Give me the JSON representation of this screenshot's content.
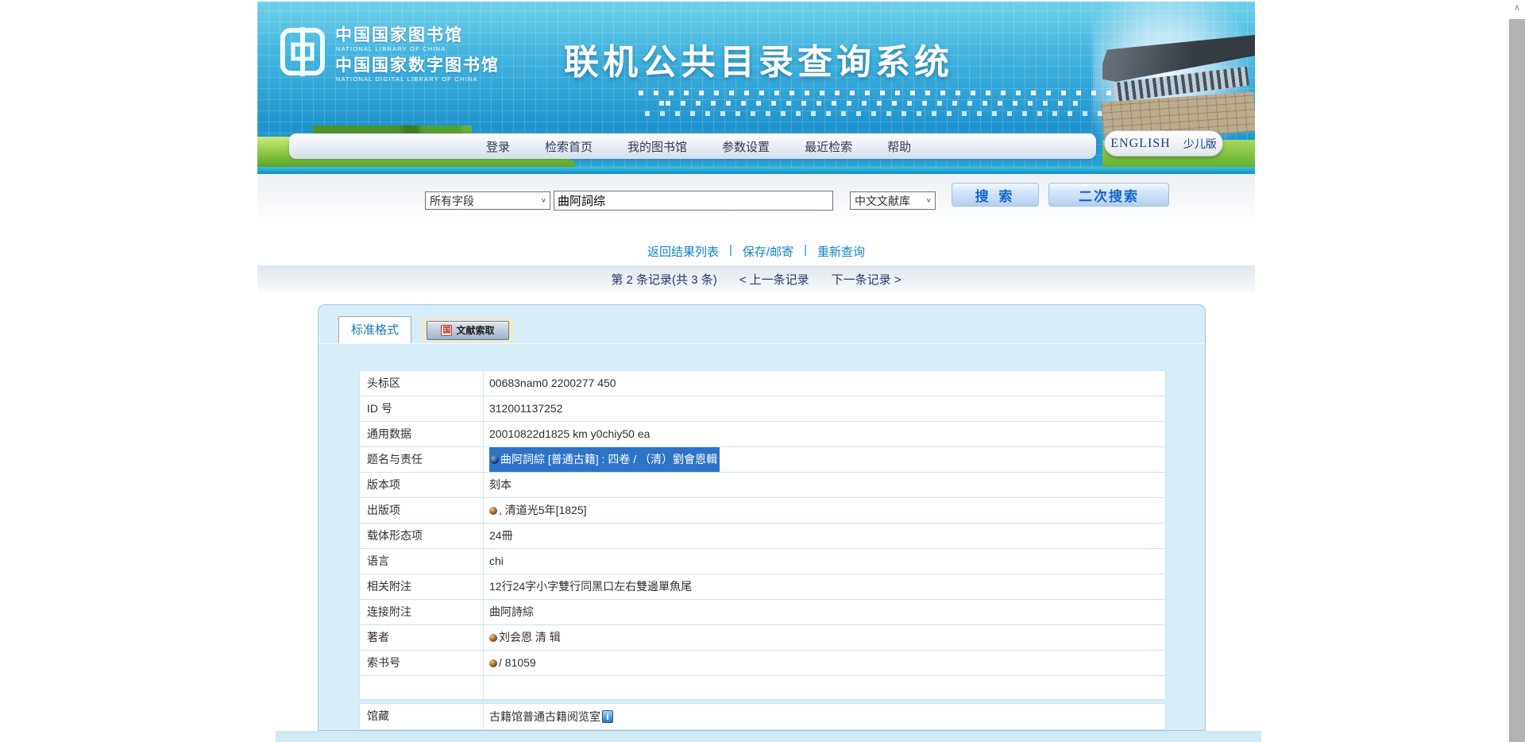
{
  "header": {
    "logo": {
      "line1_cn": "中国国家图书馆",
      "line1_en": "NATIONAL LIBRARY OF CHINA",
      "line2_cn": "中国国家数字图书馆",
      "line2_en": "NATIONAL DIGITAL LIBRARY OF CHINA"
    },
    "banner_title": "联机公共目录查询系统",
    "nav_items": [
      "登录",
      "检索首页",
      "我的图书馆",
      "参数设置",
      "最近检索",
      "帮助"
    ],
    "lang": {
      "english": "ENGLISH",
      "kids": "少儿版"
    }
  },
  "search_bar": {
    "field_select_value": "所有字段",
    "query_value": "曲阿詞综",
    "db_select_value": "中文文献库",
    "search_button": "搜 索",
    "secondary_search_button": "二次搜索"
  },
  "result_toolbar": {
    "links": [
      "返回结果列表",
      "保存/邮寄",
      "重新查询"
    ],
    "separator": "|"
  },
  "record_nav": {
    "position_text": "第 2 条记录(共 3 条)",
    "prev_link": "< 上一条记录",
    "next_link": "下一条记录 >"
  },
  "tabs": {
    "standard_format": "标准格式",
    "document_request": "文献索取"
  },
  "record_table": {
    "rows": [
      {
        "label": "头标区",
        "value": "00683nam0 2200277 450"
      },
      {
        "label": "ID 号",
        "value": "312001137252"
      },
      {
        "label": "通用数据",
        "value": "20010822d1825 km y0chiy50 ea"
      },
      {
        "label": "题名与责任",
        "value": "曲阿詞綜 [普通古籍] : 四卷 / （清）劉會恩輯",
        "highlighted": true,
        "marker": "blue-ball-icon"
      },
      {
        "label": "版本项",
        "value": "刻本"
      },
      {
        "label": "出版项",
        "value": ", 清道光5年[1825]",
        "marker": "brown-ball-icon"
      },
      {
        "label": "载体形态项",
        "value": "24冊"
      },
      {
        "label": "语言",
        "value": "chi"
      },
      {
        "label": "相关附注",
        "value": "12行24字小字雙行同黑口左右雙邊單魚尾"
      },
      {
        "label": "连接附注",
        "value": "曲阿詩綜"
      },
      {
        "label": "著者",
        "value": "刘会恩 清 辑",
        "marker": "brown-ball-icon"
      },
      {
        "label": "索书号",
        "value": "/ 81059",
        "marker": "brown-ball-icon"
      },
      {
        "label": "",
        "value": ""
      }
    ]
  },
  "holdings_table": {
    "label": "馆藏",
    "value": "古籍馆普通古籍阅览室",
    "icon": "info-icon"
  },
  "icons": {
    "dropdown_glyph": "∨",
    "scroll_up_glyph": "∧",
    "info_glyph": "i",
    "nlc_mini_logo_glyph": "国"
  },
  "colors": {
    "accent_blue": "#1466c8",
    "link_blue": "#1583c5",
    "selection_blue": "#2d74c9",
    "panel_blue": "#d7eef8",
    "footer_blue": "#cfe9f5"
  }
}
